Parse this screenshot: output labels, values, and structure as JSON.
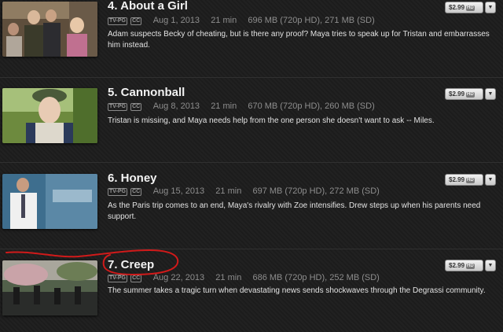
{
  "episodes": [
    {
      "number_title": "4. About a Girl",
      "rating": "TV-PG",
      "cc": "CC",
      "date": "Aug 1, 2013",
      "duration": "21 min",
      "size": "696 MB (720p HD), 271 MB (SD)",
      "description": "Adam suspects Becky of cheating, but is there any proof? Maya tries to speak up for Tristan and embarrasses him instead.",
      "price": "$2.99",
      "hd": "HD"
    },
    {
      "number_title": "5. Cannonball",
      "rating": "TV-PG",
      "cc": "CC",
      "date": "Aug 8, 2013",
      "duration": "21 min",
      "size": "670 MB (720p HD), 260 MB (SD)",
      "description": "Tristan is missing, and Maya needs help from the one person she doesn't want to ask -- Miles.",
      "price": "$2.99",
      "hd": "HD"
    },
    {
      "number_title": "6. Honey",
      "rating": "TV-PG",
      "cc": "CC",
      "date": "Aug 15, 2013",
      "duration": "21 min",
      "size": "697 MB (720p HD), 272 MB (SD)",
      "description": "As the Paris trip comes to an end, Maya's rivalry with Zoe intensifies. Drew steps up when his parents need support.",
      "price": "$2.99",
      "hd": "HD"
    },
    {
      "number_title": "7. Creep",
      "rating": "TV-PG",
      "cc": "CC",
      "date": "Aug 22, 2013",
      "duration": "21 min",
      "size": "686 MB (720p HD), 252 MB (SD)",
      "description": "The summer takes a tragic turn when devastating news sends shockwaves through the Degrassi community.",
      "price": "$2.99",
      "hd": "HD"
    }
  ],
  "colors": {
    "background": "#1d1d1d",
    "title": "#f2f2f2",
    "meta": "#8e8e8e",
    "annotation": "#d11a1a"
  },
  "icons": {
    "dropdown": "chevron-down-icon"
  }
}
